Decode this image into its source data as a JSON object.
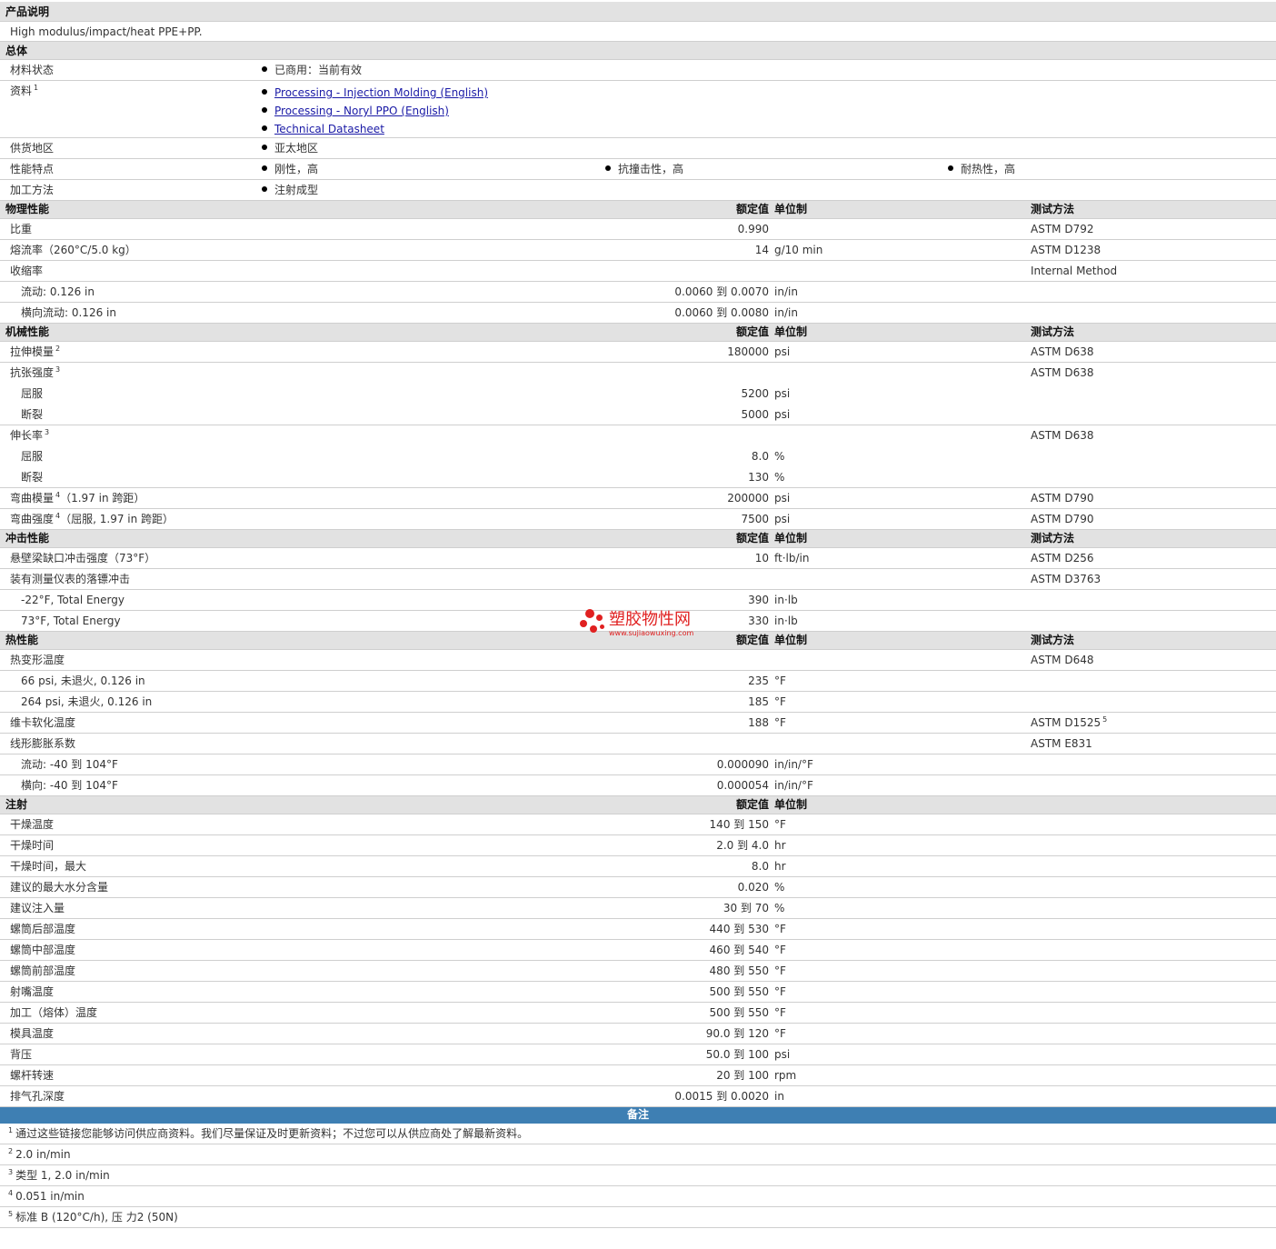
{
  "product": {
    "header": "产品说明",
    "description": "High modulus/impact/heat PPE+PP."
  },
  "general": {
    "header": "总体",
    "material_status_label": "材料状态",
    "material_status": "已商用：当前有效",
    "docs_label": "资料",
    "docs_note": "1",
    "docs": [
      "Processing - Injection Molding (English)",
      "Processing - Noryl PPO (English)",
      "Technical Datasheet"
    ],
    "region_label": "供货地区",
    "region": "亚太地区",
    "features_label": "性能特点",
    "features": [
      "刚性，高",
      "抗撞击性，高",
      "耐热性，高"
    ],
    "process_label": "加工方法",
    "process": "注射成型"
  },
  "columns": {
    "value": "额定值",
    "unit": "单位制",
    "test": "测试方法"
  },
  "physical": {
    "header": "物理性能",
    "rows": [
      {
        "label": "比重",
        "value": "0.990",
        "unit": "",
        "test": "ASTM D792"
      },
      {
        "label": "熔流率（260°C/5.0 kg）",
        "value": "14",
        "unit": "g/10 min",
        "test": "ASTM D1238"
      },
      {
        "label": "收缩率",
        "value": "",
        "unit": "",
        "test": "Internal Method"
      },
      {
        "label": "流动: 0.126 in",
        "value": "0.0060 到  0.0070",
        "unit": "in/in",
        "test": ""
      },
      {
        "label": "横向流动: 0.126 in",
        "value": "0.0060 到  0.0080",
        "unit": "in/in",
        "test": ""
      }
    ]
  },
  "mechanical": {
    "header": "机械性能",
    "rows": [
      {
        "label": "拉伸模量",
        "note": "2",
        "value": "180000",
        "unit": "psi",
        "test": "ASTM D638"
      },
      {
        "label": "抗张强度",
        "note": "3",
        "value": "",
        "unit": "",
        "test": "ASTM D638"
      },
      {
        "label": "屈服",
        "value": "5200",
        "unit": "psi",
        "test": ""
      },
      {
        "label": "断裂",
        "value": "5000",
        "unit": "psi",
        "test": ""
      },
      {
        "label": "伸长率",
        "note": "3",
        "value": "",
        "unit": "",
        "test": "ASTM D638"
      },
      {
        "label": "屈服",
        "value": "8.0",
        "unit": "%",
        "test": ""
      },
      {
        "label": "断裂",
        "value": "130",
        "unit": "%",
        "test": ""
      },
      {
        "label": "弯曲模量",
        "note": "4",
        "suffix": "（1.97 in 跨距）",
        "value": "200000",
        "unit": "psi",
        "test": "ASTM D790"
      },
      {
        "label": "弯曲强度",
        "note": "4",
        "suffix": "（屈服, 1.97 in 跨距）",
        "value": "7500",
        "unit": "psi",
        "test": "ASTM D790"
      }
    ]
  },
  "impact": {
    "header": "冲击性能",
    "rows": [
      {
        "label": "悬壁梁缺口冲击强度（73°F）",
        "value": "10",
        "unit": "ft·lb/in",
        "test": "ASTM D256"
      },
      {
        "label": "装有测量仪表的落镖冲击",
        "value": "",
        "unit": "",
        "test": "ASTM D3763"
      },
      {
        "label": "-22°F, Total Energy",
        "value": "390",
        "unit": "in·lb",
        "test": ""
      },
      {
        "label": "73°F, Total Energy",
        "value": "330",
        "unit": "in·lb",
        "test": ""
      }
    ]
  },
  "thermal": {
    "header": "热性能",
    "rows": [
      {
        "label": "热变形温度",
        "value": "",
        "unit": "",
        "test": "ASTM D648"
      },
      {
        "label": "66 psi, 未退火, 0.126 in",
        "value": "235",
        "unit": "°F",
        "test": ""
      },
      {
        "label": "264 psi, 未退火, 0.126 in",
        "value": "185",
        "unit": "°F",
        "test": ""
      },
      {
        "label": "维卡软化温度",
        "value": "188",
        "unit": "°F",
        "test": "ASTM D1525",
        "test_note": "5"
      },
      {
        "label": "线形膨胀系数",
        "value": "",
        "unit": "",
        "test": "ASTM E831"
      },
      {
        "label": "流动: -40 到  104°F",
        "value": "0.000090",
        "unit": "in/in/°F",
        "test": ""
      },
      {
        "label": "横向: -40 到  104°F",
        "value": "0.000054",
        "unit": "in/in/°F",
        "test": ""
      }
    ]
  },
  "injection": {
    "header": "注射",
    "rows": [
      {
        "label": "干燥温度",
        "value": "140 到  150",
        "unit": "°F"
      },
      {
        "label": "干燥时间",
        "value": "2.0 到  4.0",
        "unit": "hr"
      },
      {
        "label": "干燥时间，最大",
        "value": "8.0",
        "unit": "hr"
      },
      {
        "label": "建议的最大水分含量",
        "value": "0.020",
        "unit": "%"
      },
      {
        "label": "建议注入量",
        "value": "30 到  70",
        "unit": "%"
      },
      {
        "label": "螺筒后部温度",
        "value": "440 到  530",
        "unit": "°F"
      },
      {
        "label": "螺筒中部温度",
        "value": "460 到  540",
        "unit": "°F"
      },
      {
        "label": "螺筒前部温度",
        "value": "480 到  550",
        "unit": "°F"
      },
      {
        "label": "射嘴温度",
        "value": "500 到  550",
        "unit": "°F"
      },
      {
        "label": "加工（熔体）温度",
        "value": "500 到  550",
        "unit": "°F"
      },
      {
        "label": "模具温度",
        "value": "90.0 到  120",
        "unit": "°F"
      },
      {
        "label": "背压",
        "value": "50.0 到  100",
        "unit": "psi"
      },
      {
        "label": "螺杆转速",
        "value": "20 到  100",
        "unit": "rpm"
      },
      {
        "label": "排气孔深度",
        "value": "0.0015 到  0.0020",
        "unit": "in"
      }
    ]
  },
  "notes": {
    "header": "备注",
    "items": [
      {
        "num": "1",
        "text": "通过这些链接您能够访问供应商资料。我们尽量保证及时更新资料；不过您可以从供应商处了解最新资料。"
      },
      {
        "num": "2",
        "text": "2.0 in/min"
      },
      {
        "num": "3",
        "text": "类型  1, 2.0 in/min"
      },
      {
        "num": "4",
        "text": "0.051 in/min"
      },
      {
        "num": "5",
        "text": "标准  B (120°C/h), 压  力2 (50N)"
      }
    ]
  },
  "watermark": {
    "text": "塑胶物性网",
    "url": "www.sujiaowuxing.com",
    "color": "#e02020"
  },
  "colors": {
    "header_bg": "#e2e2e2",
    "notes_header_bg": "#3e7fb3",
    "link": "#1a1aa6"
  }
}
